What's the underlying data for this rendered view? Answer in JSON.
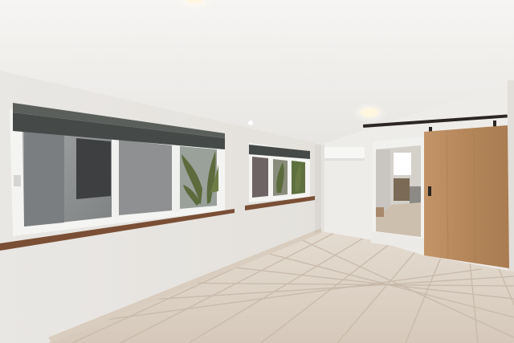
{
  "colors": {
    "ceiling": "#f3f2f0",
    "ceiling_shadow": "#ebe9e6",
    "wall_left": "#e7e4e0",
    "wall_right": "#eeece9",
    "floor": "#dcd1c5",
    "floor_grout": "#c9bcae",
    "baseboard": "#d8cdc0",
    "sill_wood": "#7a4f35",
    "window_frame": "#f4f4f2",
    "window_glass": "#8d8f90",
    "shade": "#454a48",
    "plant": "#5b6b3c",
    "door_wood": "#b98b5f",
    "door_rail": "#2b2623",
    "light": "#fff6df",
    "ac_unit": "#f7f7f6",
    "room_beyond": "#d4d0ca"
  }
}
